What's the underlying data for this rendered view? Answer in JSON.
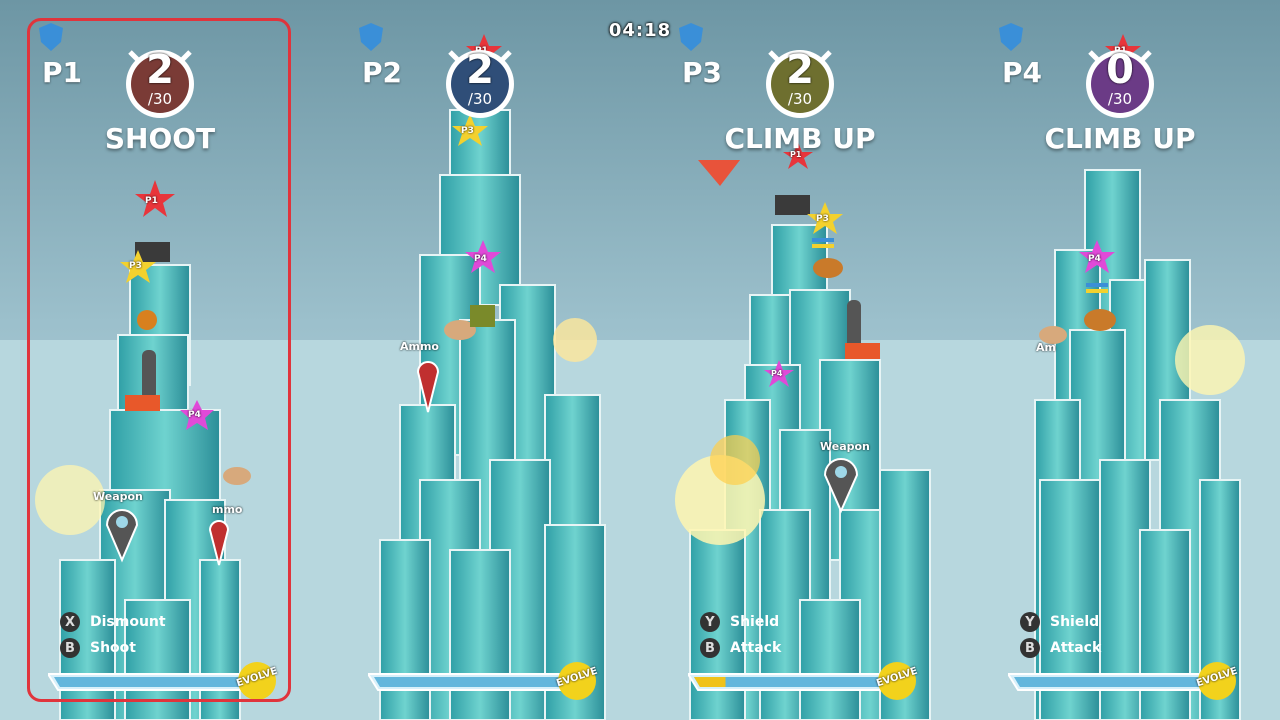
{
  "timer": "04:18",
  "players": [
    {
      "label": "P1",
      "score": "2",
      "score_total": "/30",
      "action": "SHOOT",
      "score_color": "#7a3b36",
      "buttons": [
        {
          "key": "X",
          "label": "Dismount"
        },
        {
          "key": "B",
          "label": "Shoot"
        }
      ],
      "pins": [
        {
          "label": "Weapon"
        },
        {
          "label": "mmo"
        }
      ],
      "stars": [
        "P1",
        "P3",
        "P4"
      ],
      "evolve": "EVOLVE",
      "progress": 0,
      "selected": true
    },
    {
      "label": "P2",
      "score": "2",
      "score_total": "/30",
      "action": "",
      "score_color": "#2f4e78",
      "buttons": [],
      "pins": [
        {
          "label": "Ammo"
        }
      ],
      "stars": [
        "P1",
        "P3",
        "P4"
      ],
      "evolve": "EVOLVE",
      "progress": 0,
      "selected": false
    },
    {
      "label": "P3",
      "score": "2",
      "score_total": "/30",
      "action": "CLIMB UP",
      "score_color": "#6e6f2f",
      "buttons": [
        {
          "key": "Y",
          "label": "Shield"
        },
        {
          "key": "B",
          "label": "Attack"
        }
      ],
      "pins": [
        {
          "label": "Weapon"
        }
      ],
      "stars": [
        "P1",
        "P3",
        "P4"
      ],
      "evolve": "EVOLVE",
      "progress": 0.15,
      "selected": false
    },
    {
      "label": "P4",
      "score": "0",
      "score_total": "/30",
      "action": "CLIMB UP",
      "score_color": "#6b3b86",
      "buttons": [
        {
          "key": "Y",
          "label": "Shield"
        },
        {
          "key": "B",
          "label": "Attack"
        }
      ],
      "pins": [
        {
          "label": "Am"
        }
      ],
      "stars": [
        "P1",
        "P4"
      ],
      "evolve": "EVOLVE",
      "progress": 0,
      "selected": false
    }
  ],
  "colors": {
    "p1": "#e8353b",
    "p2": "#3a7fd0",
    "p3": "#f3d12e",
    "p4": "#e04ad8",
    "ice": "#3fb3b3",
    "bar": "#62b6dc",
    "shield": "#3a8fd8"
  }
}
